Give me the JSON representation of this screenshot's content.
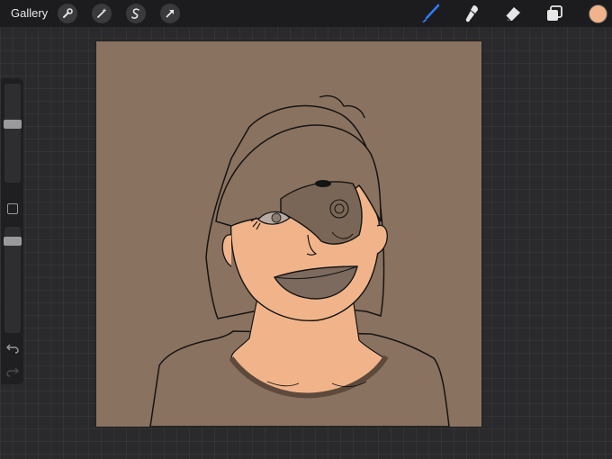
{
  "topbar": {
    "gallery_label": "Gallery",
    "left_tools": [
      "actions-wrench-icon",
      "adjustments-magic-wand-icon",
      "selection-s-icon",
      "transform-arrow-icon"
    ],
    "right_tools": [
      "brush-icon",
      "smudge-icon",
      "eraser-icon",
      "layers-icon"
    ],
    "active_tool": "brush-icon",
    "accent_color": "#2f7bf5",
    "current_color": "#f1b48a"
  },
  "sidebar": {
    "brush_size_level": 0.6,
    "opacity_level": 0.9,
    "tools": [
      "modifier-square-icon",
      "undo-icon",
      "redo-icon"
    ]
  },
  "canvas": {
    "background_color": "#8a7260",
    "skin_color": "#f1b48a",
    "hair_color": "#8a7260",
    "shirt_color": "#8a7260",
    "line_color": "#141414"
  }
}
